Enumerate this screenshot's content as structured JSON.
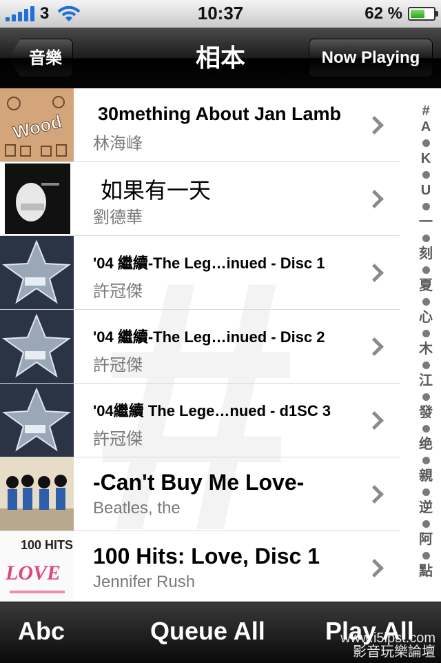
{
  "status": {
    "carrier": "3",
    "time": "10:37",
    "battery_text": "62 %",
    "battery_level": 0.62
  },
  "nav": {
    "back_label": "音樂",
    "title": "相本",
    "now_playing_label": "Now Playing"
  },
  "albums": [
    {
      "title": "30mething About Jan Lamb",
      "artist": "林海峰"
    },
    {
      "title": "如果有一天",
      "artist": "劉德華"
    },
    {
      "title": "'04 繼續-The Leg…inued - Disc 1",
      "artist": "許冠傑"
    },
    {
      "title": "'04 繼續-The Leg…inued - Disc 2",
      "artist": "許冠傑"
    },
    {
      "title": "'04繼續 The Lege…nued - d1SC 3",
      "artist": "許冠傑"
    },
    {
      "title": "-Can't Buy Me Love-",
      "artist": "Beatles, the"
    },
    {
      "title": "100 Hits: Love, Disc 1",
      "artist": "Jennifer Rush"
    }
  ],
  "album_art_text": {
    "wood": "Wood",
    "love": "LOVE",
    "hits": "100 HITS"
  },
  "index": [
    "#",
    "A",
    "•",
    "K",
    "•",
    "U",
    "•",
    "一",
    "•",
    "刻",
    "•",
    "夏",
    "•",
    "心",
    "•",
    "木",
    "•",
    "江",
    "•",
    "發",
    "•",
    "绝",
    "•",
    "親",
    "•",
    "逆",
    "•",
    "阿",
    "•",
    "點"
  ],
  "toolbar": {
    "abc": "Abc",
    "queue_all": "Queue All",
    "play_all": "Play All"
  },
  "watermark": {
    "line1": "www.i5ipst.com",
    "line2": "影音玩樂論壇"
  }
}
